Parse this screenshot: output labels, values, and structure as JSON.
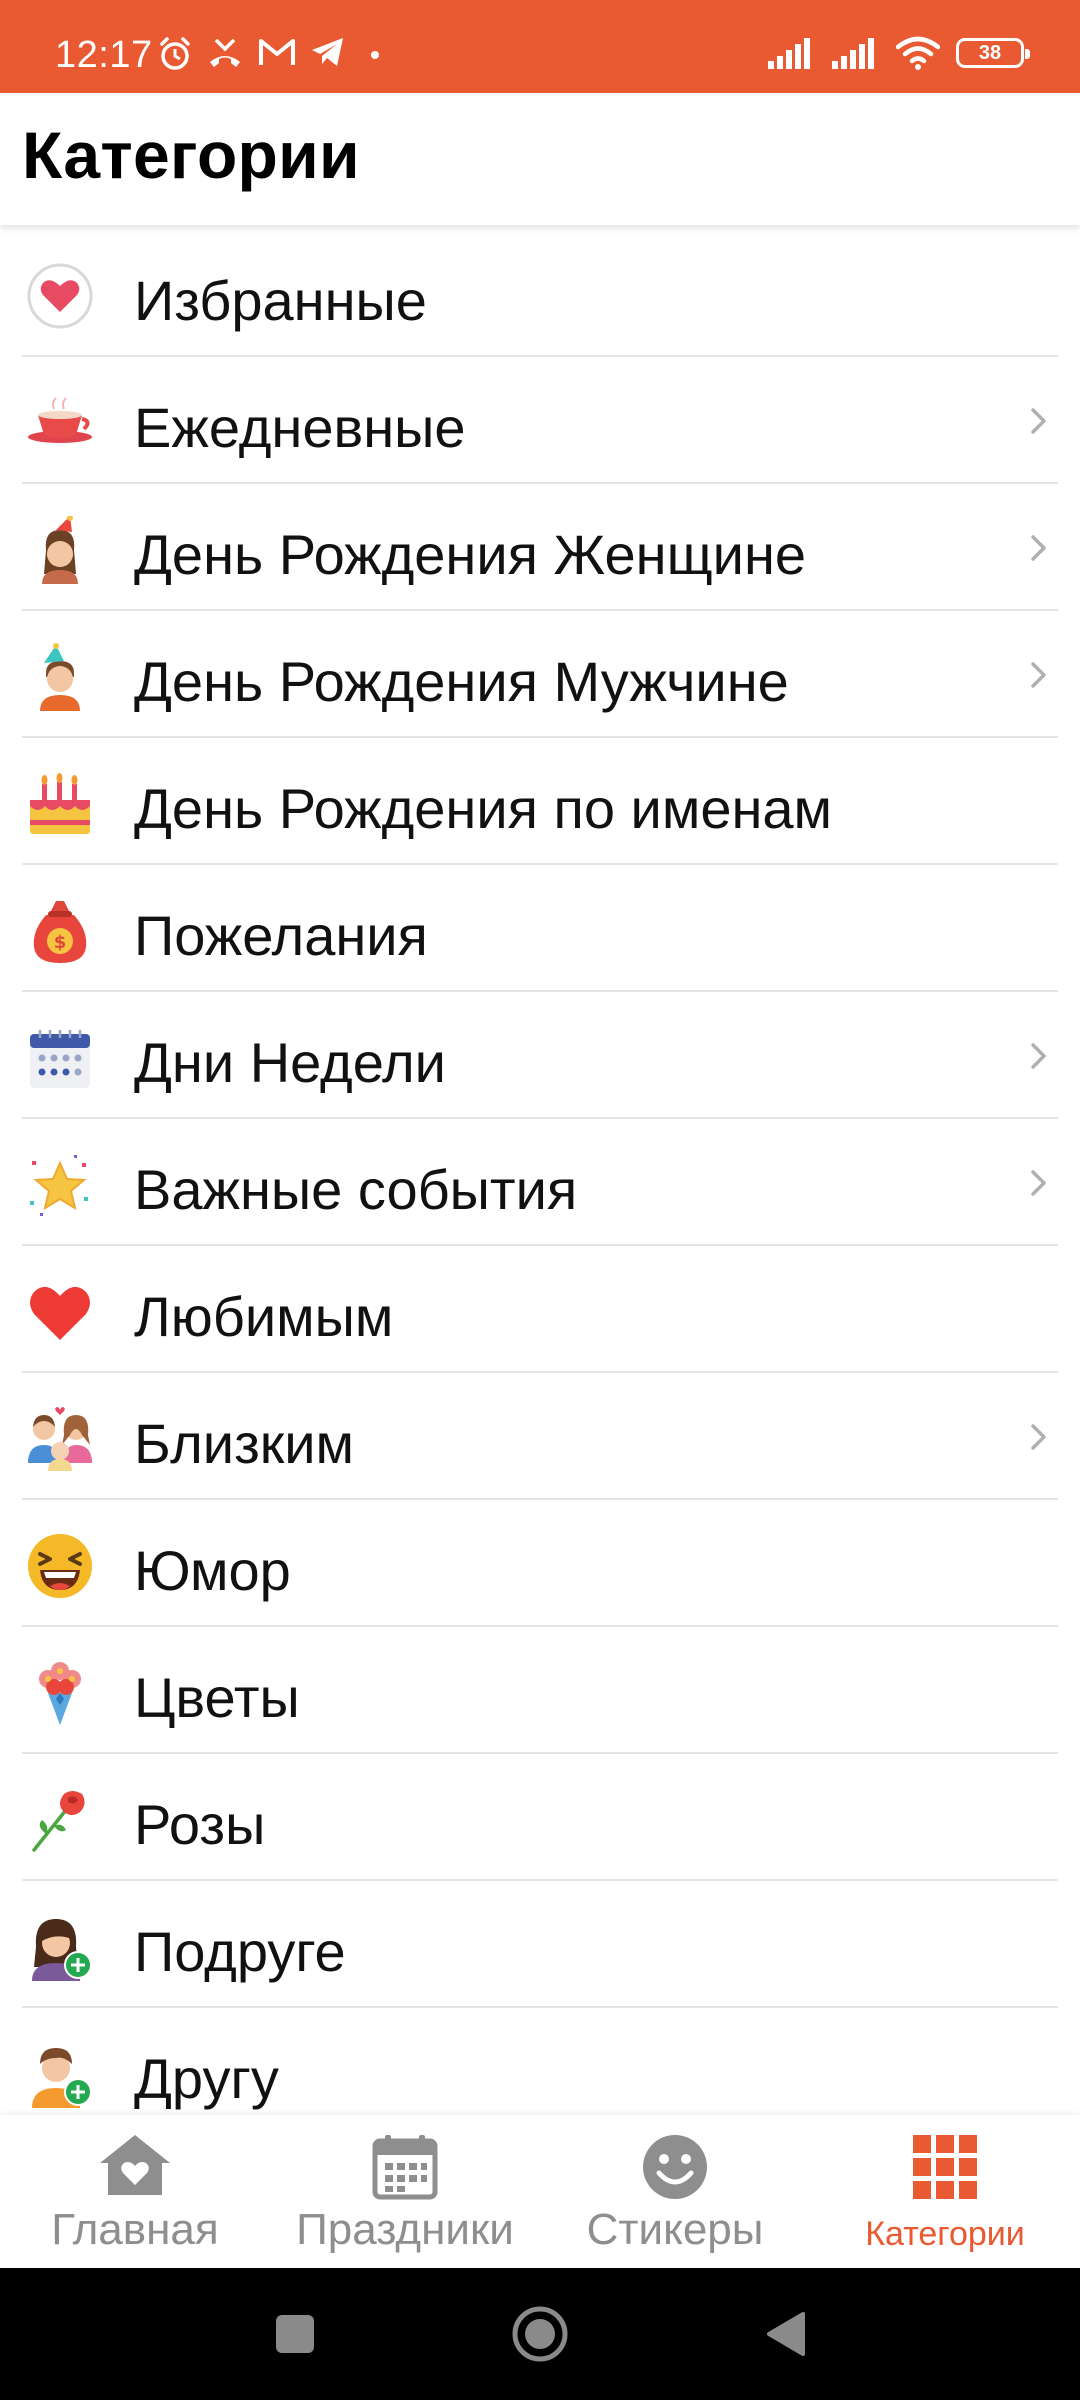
{
  "status_bar": {
    "time": "12:17",
    "battery_level": "38",
    "background_color": "#e95a32",
    "icons": [
      "alarm-icon",
      "missed-call-icon",
      "gmail-icon",
      "telegram-icon",
      "dot-icon",
      "signal-icon",
      "signal-icon",
      "wifi-icon",
      "battery-icon"
    ]
  },
  "header": {
    "title": "Категории"
  },
  "categories": [
    {
      "label": "Избранные",
      "icon": "heart-circle-icon",
      "has_chevron": false
    },
    {
      "label": "Ежедневные",
      "icon": "coffee-cup-icon",
      "has_chevron": true
    },
    {
      "label": "День Рождения Женщине",
      "icon": "woman-party-hat-icon",
      "has_chevron": true
    },
    {
      "label": "День Рождения Мужчине",
      "icon": "man-party-hat-icon",
      "has_chevron": true
    },
    {
      "label": "День Рождения по именам",
      "icon": "birthday-cake-icon",
      "has_chevron": false
    },
    {
      "label": "Пожелания",
      "icon": "money-bag-icon",
      "has_chevron": false
    },
    {
      "label": "Дни Недели",
      "icon": "calendar-icon",
      "has_chevron": true
    },
    {
      "label": "Важные события",
      "icon": "star-confetti-icon",
      "has_chevron": true
    },
    {
      "label": "Любимым",
      "icon": "red-heart-icon",
      "has_chevron": false
    },
    {
      "label": "Близким",
      "icon": "family-icon",
      "has_chevron": true
    },
    {
      "label": "Юмор",
      "icon": "laughing-face-icon",
      "has_chevron": false
    },
    {
      "label": "Цветы",
      "icon": "bouquet-icon",
      "has_chevron": false
    },
    {
      "label": "Розы",
      "icon": "rose-icon",
      "has_chevron": false
    },
    {
      "label": "Подруге",
      "icon": "woman-plus-icon",
      "has_chevron": false
    },
    {
      "label": "Другу",
      "icon": "man-plus-icon",
      "has_chevron": false
    }
  ],
  "bottom_nav": {
    "items": [
      {
        "label": "Главная",
        "icon": "home-heart-icon",
        "active": false
      },
      {
        "label": "Праздники",
        "icon": "calendar-icon",
        "active": false
      },
      {
        "label": "Стикеры",
        "icon": "smiley-icon",
        "active": false
      },
      {
        "label": "Категории",
        "icon": "grid-icon",
        "active": true
      }
    ],
    "active_color": "#e95a32",
    "inactive_color": "#8e8e8e"
  },
  "system_nav": {
    "buttons": [
      "recents-button",
      "home-button",
      "back-button"
    ]
  }
}
